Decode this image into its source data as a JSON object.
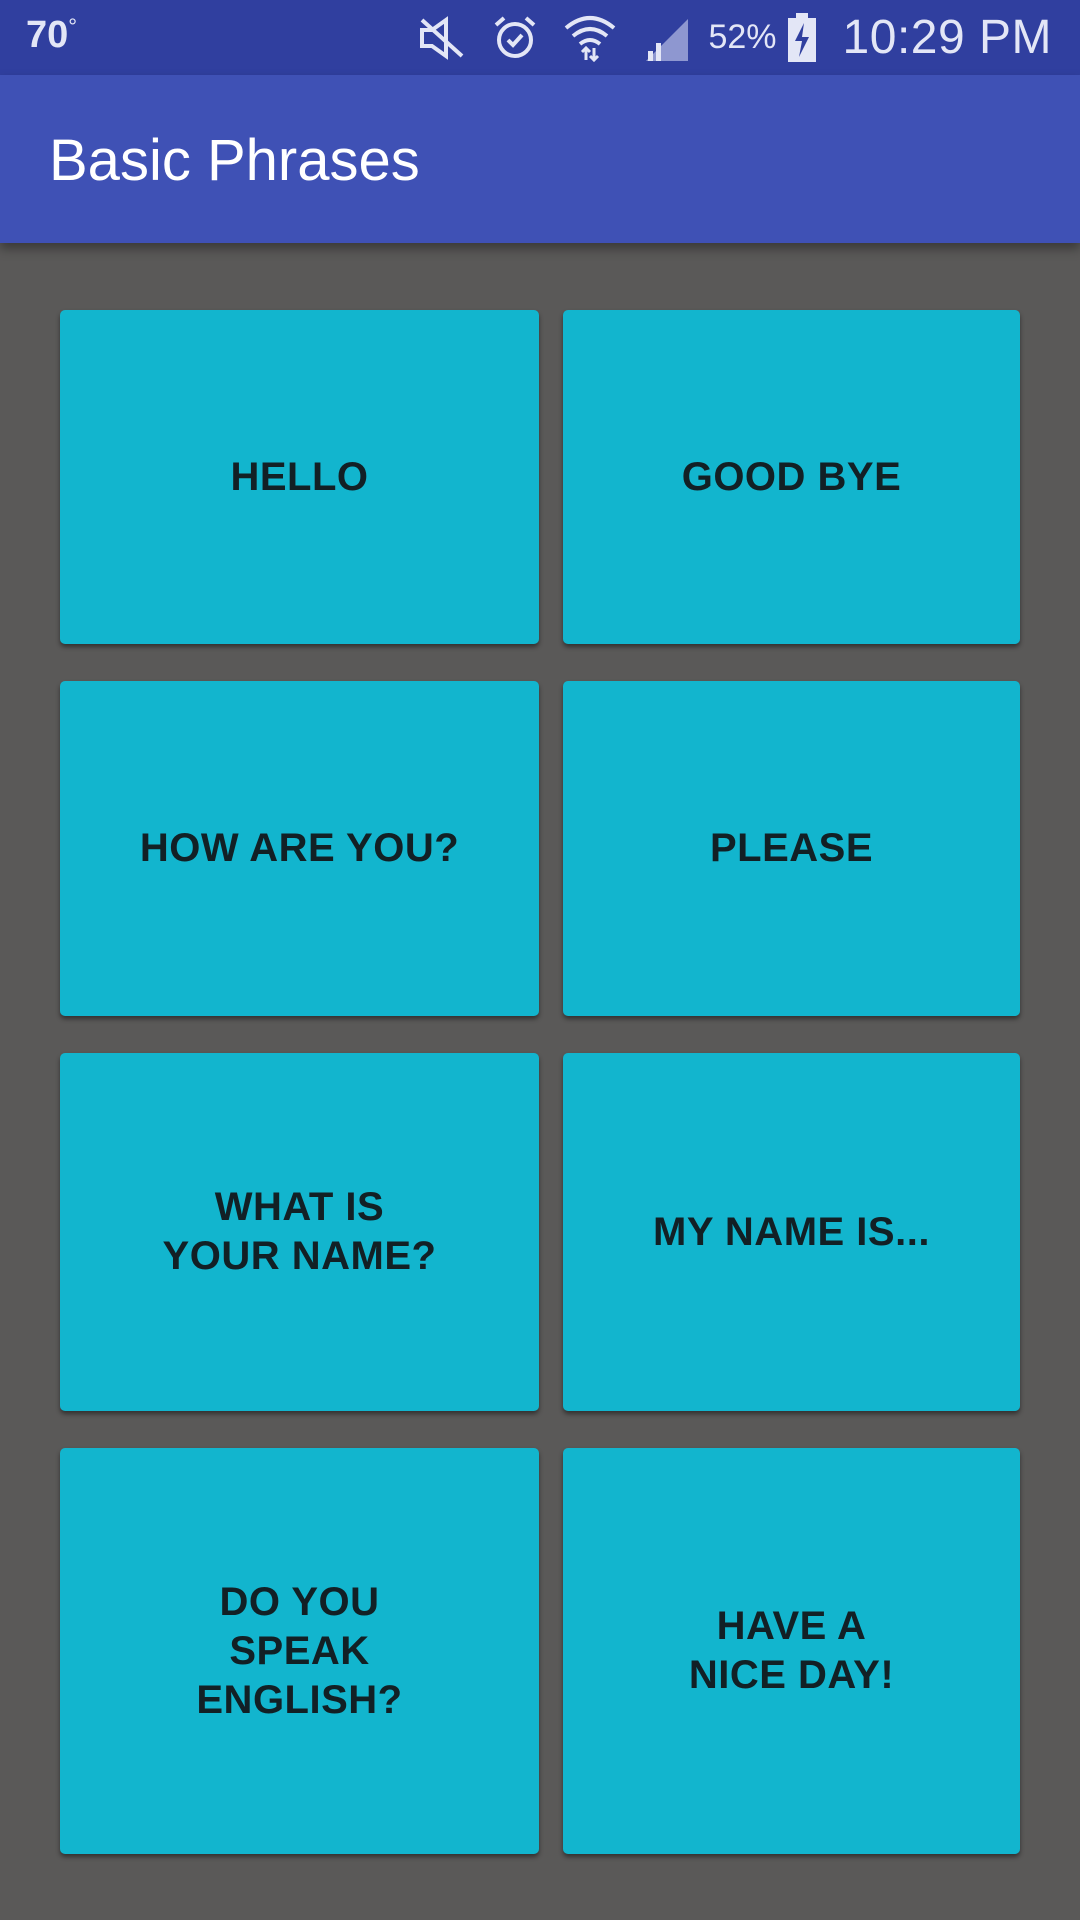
{
  "status_bar": {
    "temperature": "70",
    "degree_symbol": "°",
    "icons": [
      "mute-icon",
      "alarm-icon",
      "wifi-icon",
      "signal-icon",
      "battery-charging-icon"
    ],
    "battery_percent": "52%",
    "time": "10:29 PM"
  },
  "app_bar": {
    "title": "Basic Phrases",
    "color": "#3f51b5"
  },
  "phrases": [
    {
      "label": "HELLO"
    },
    {
      "label": "GOOD BYE"
    },
    {
      "label": "HOW ARE YOU?"
    },
    {
      "label": "PLEASE"
    },
    {
      "label": "WHAT IS\nYOUR NAME?"
    },
    {
      "label": "MY NAME IS..."
    },
    {
      "label": "DO YOU\nSPEAK\nENGLISH?"
    },
    {
      "label": "HAVE A\nNICE DAY!"
    }
  ],
  "colors": {
    "tile": "#12b5ce",
    "background": "#5a5958",
    "status_bar": "#303f9f"
  }
}
